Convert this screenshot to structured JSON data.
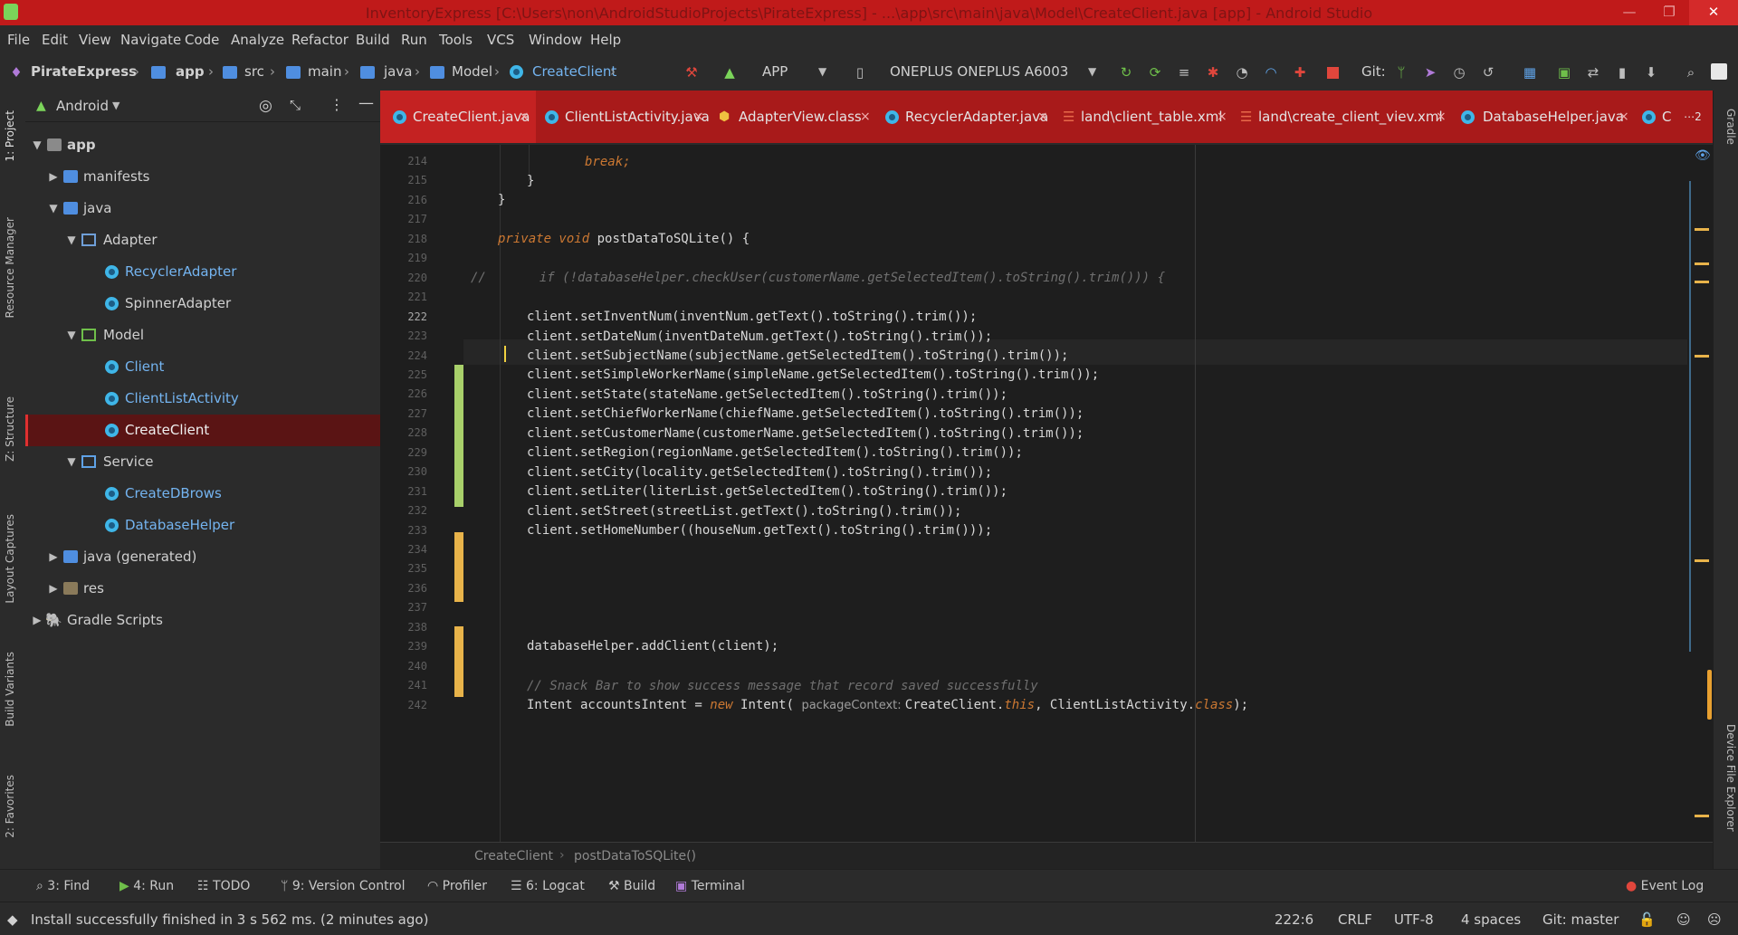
{
  "window": {
    "title": "InventoryExpress [C:\\Users\\non\\AndroidStudioProjects\\PirateExpress] - ...\\app\\src\\main\\java\\Model\\CreateClient.java [app] - Android Studio",
    "controls": [
      "—",
      "❐",
      "✕"
    ]
  },
  "menu": [
    "File",
    "Edit",
    "View",
    "Navigate",
    "Code",
    "Analyze",
    "Refactor",
    "Build",
    "Run",
    "Tools",
    "VCS",
    "Window",
    "Help"
  ],
  "breadcrumbs": [
    "PirateExpress",
    "app",
    "src",
    "main",
    "java",
    "Model",
    "CreateClient"
  ],
  "run_config": "APP",
  "device": "ONEPLUS ONEPLUS A6003",
  "git_label": "Git:",
  "project_panel": {
    "view_mode": "Android",
    "tree": [
      {
        "label": "app"
      },
      {
        "label": "manifests"
      },
      {
        "label": "java"
      },
      {
        "label": "Adapter"
      },
      {
        "label": "RecyclerAdapter"
      },
      {
        "label": "SpinnerAdapter"
      },
      {
        "label": "Model"
      },
      {
        "label": "Client"
      },
      {
        "label": "ClientListActivity"
      },
      {
        "label": "CreateClient"
      },
      {
        "label": "Service"
      },
      {
        "label": "CreateDBrows"
      },
      {
        "label": "DatabaseHelper"
      },
      {
        "label": "java (generated)"
      },
      {
        "label": "res"
      },
      {
        "label": "Gradle Scripts"
      }
    ]
  },
  "left_tool_tabs": [
    "1: Project",
    "Resource Manager",
    "Z: Structure",
    "Layout Captures",
    "Build Variants",
    "2: Favorites"
  ],
  "right_tool_tabs": [
    "Gradle",
    "Device File Explorer"
  ],
  "editor_tabs": [
    {
      "label": "CreateClient.java",
      "close": "×"
    },
    {
      "label": "ClientListActivity.java",
      "close": "×"
    },
    {
      "label": "AdapterView.class",
      "close": "×"
    },
    {
      "label": "RecyclerAdapter.java",
      "close": "×"
    },
    {
      "label": "land\\client_table.xml",
      "close": "×"
    },
    {
      "label": "land\\create_client_viev.xml",
      "close": "×"
    },
    {
      "label": "DatabaseHelper.java",
      "close": "×"
    },
    {
      "label": "C",
      "close": ""
    }
  ],
  "tabs_overflow": "⋯2",
  "line_numbers": [
    "214",
    "215",
    "216",
    "217",
    "218",
    "219",
    "220",
    "221",
    "222",
    "223",
    "224",
    "225",
    "226",
    "227",
    "228",
    "229",
    "230",
    "231",
    "232",
    "233",
    "234",
    "235",
    "236",
    "237",
    "238",
    "239",
    "240",
    "241",
    "242"
  ],
  "code": {
    "l214": "break;",
    "l215": "}",
    "l216": "}",
    "l218_kw": "private void",
    "l218_rest": " postDataToSQLite() {",
    "l220": "//       if (!databaseHelper.checkUser(customerName.getSelectedItem().toString().trim())) {",
    "l222": "client.setInventNum(inventNum.getText().toString().trim());",
    "l223": "client.setDateNum(inventDateNum.getText().toString().trim());",
    "l224": "client.setSubjectName(subjectName.getSelectedItem().toString().trim());",
    "l225": "client.setSimpleWorkerName(simpleName.getSelectedItem().toString().trim());",
    "l226": "client.setState(stateName.getSelectedItem().toString().trim());",
    "l227": "client.setChiefWorkerName(chiefName.getSelectedItem().toString().trim());",
    "l228": "client.setCustomerName(customerName.getSelectedItem().toString().trim());",
    "l229": "client.setRegion(regionName.getSelectedItem().toString().trim());",
    "l230": "client.setCity(locality.getSelectedItem().toString().trim());",
    "l231": "client.setLiter(literList.getSelectedItem().toString().trim());",
    "l232": "client.setStreet(streetList.getText().toString().trim());",
    "l233": "client.setHomeNumber((houseNum.getText().toString().trim()));",
    "l239": "databaseHelper.addClient(client);",
    "l241": "// Snack Bar to show success message that record saved successfully",
    "l242_a": "Intent accountsIntent = ",
    "l242_new": "new",
    "l242_b": " Intent( ",
    "l242_hint": "packageContext: ",
    "l242_c": "CreateClient.",
    "l242_this": "this",
    "l242_d": ", ClientListActivity.",
    "l242_class": "class",
    "l242_e": ");"
  },
  "editor_breadcrumb": [
    "CreateClient",
    "postDataToSQLite()"
  ],
  "tool_windows": [
    "3: Find",
    "4: Run",
    "TODO",
    "9: Version Control",
    "Profiler",
    "6: Logcat",
    "Build",
    "Terminal"
  ],
  "event_log": "Event Log",
  "status": {
    "message": "Install successfully finished in 3 s 562 ms. (2 minutes ago)",
    "position": "222:6",
    "line_sep": "CRLF",
    "encoding": "UTF-8",
    "indent": "4 spaces",
    "vcs": "Git: master"
  },
  "colors": {
    "accent": "#c01a1a",
    "tab_active": "#c42222",
    "selection": "#5a1414",
    "change_added": "#a8d06a",
    "change_modified": "#e8b34a"
  }
}
